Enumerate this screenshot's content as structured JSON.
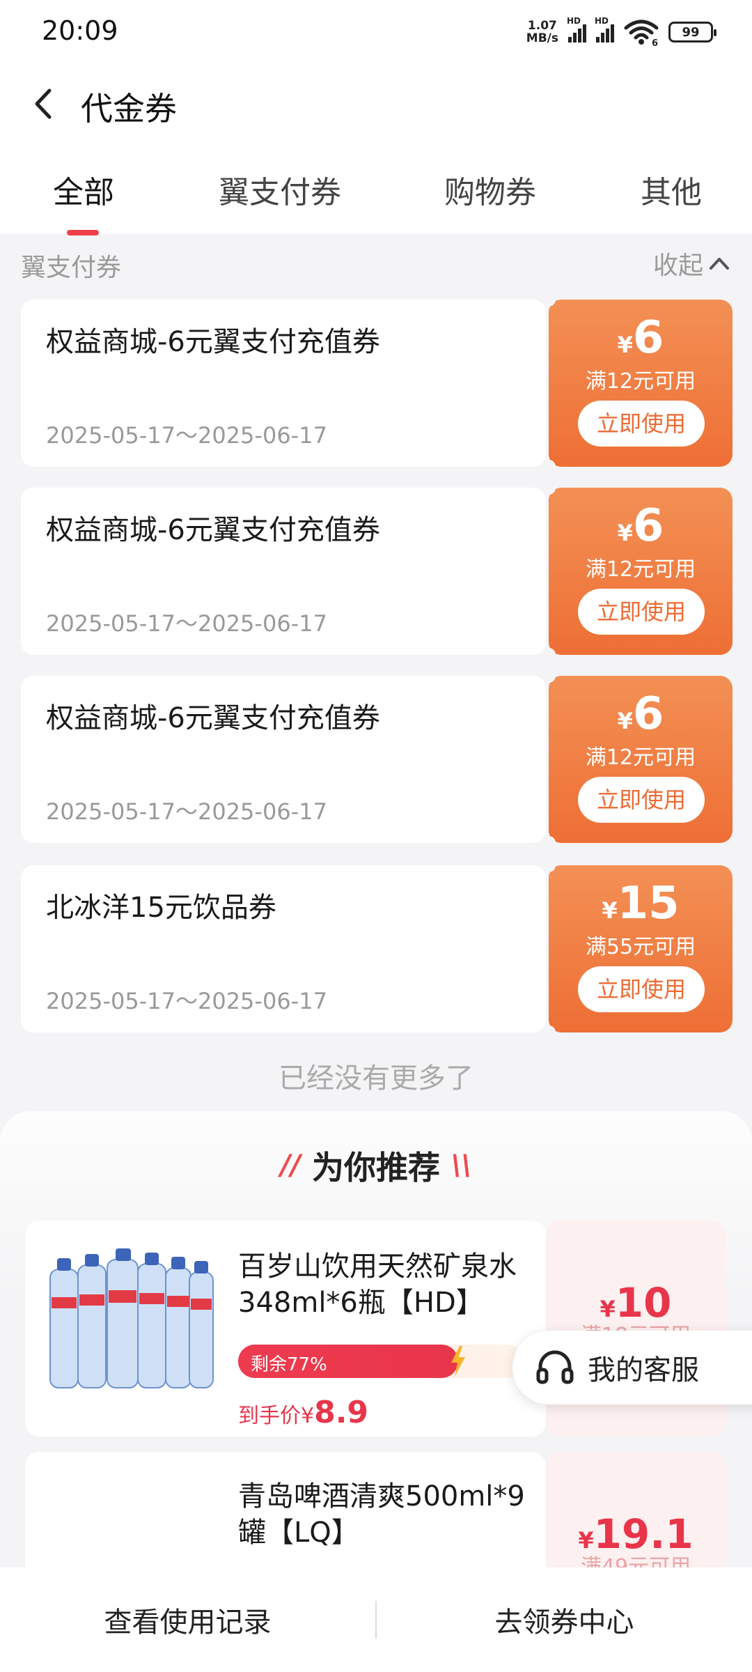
{
  "status": {
    "time": "20:09",
    "net_speed_value": "1.07",
    "net_speed_unit": "MB/s",
    "signal1": "HD",
    "signal2": "HD",
    "wifi": "6",
    "battery": "99"
  },
  "header": {
    "title": "代金券"
  },
  "tabs": [
    "全部",
    "翼支付券",
    "购物券",
    "其他"
  ],
  "section": {
    "title": "翼支付券",
    "collapse_label": "收起"
  },
  "coupons": [
    {
      "name": "权益商城-6元翼支付充值券",
      "date": "2025-05-17～2025-06-17",
      "currency": "¥",
      "amount": "6",
      "condition": "满12元可用",
      "button": "立即使用"
    },
    {
      "name": "权益商城-6元翼支付充值券",
      "date": "2025-05-17～2025-06-17",
      "currency": "¥",
      "amount": "6",
      "condition": "满12元可用",
      "button": "立即使用"
    },
    {
      "name": "权益商城-6元翼支付充值券",
      "date": "2025-05-17～2025-06-17",
      "currency": "¥",
      "amount": "6",
      "condition": "满12元可用",
      "button": "立即使用"
    },
    {
      "name": "北冰洋15元饮品券",
      "date": "2025-05-17～2025-06-17",
      "currency": "¥",
      "amount": "15",
      "condition": "满55元可用",
      "button": "立即使用"
    }
  ],
  "no_more": "已经没有更多了",
  "recommend": {
    "title": "为你推荐",
    "products": [
      {
        "name": "百岁山饮用天然矿泉水348ml*6瓶【HD】",
        "remaining": "剩余77%",
        "remaining_ratio": 0.77,
        "final_label": "到手价",
        "final_currency": "¥",
        "final_price": "8.9",
        "currency": "¥",
        "amount": "10",
        "condition": "满18元可用"
      },
      {
        "name": "青岛啤酒清爽500ml*9罐【LQ】",
        "currency": "¥",
        "amount": "19.1",
        "condition": "满49元可用"
      }
    ]
  },
  "service": {
    "label": "我的客服"
  },
  "bottom": {
    "left": "查看使用记录",
    "right": "去领券中心"
  },
  "colors": {
    "accent": "#ef3f4c",
    "coupon_orange": "#ee6f35",
    "price_red": "#e8354a"
  }
}
